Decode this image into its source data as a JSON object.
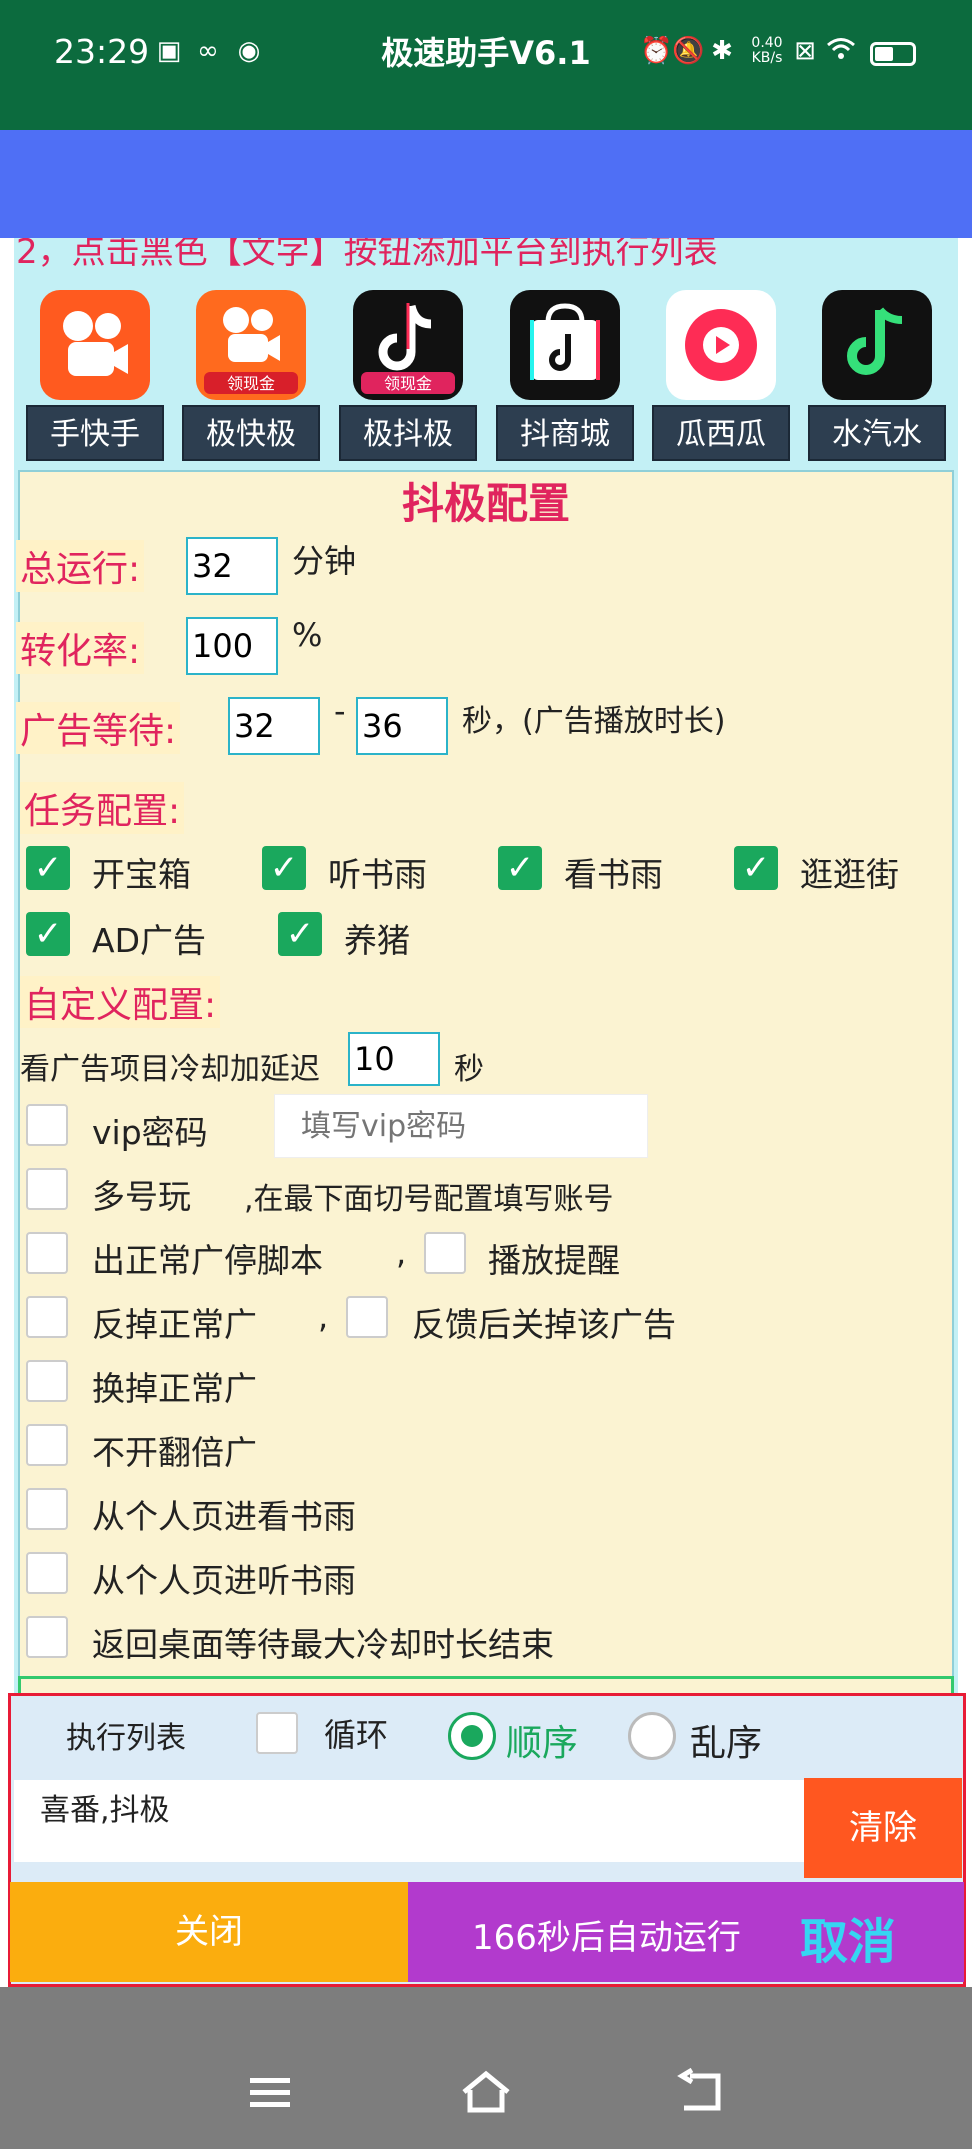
{
  "status_bar": {
    "time": "23:29",
    "net_speed_value": "0.40",
    "net_speed_unit": "KB/s",
    "icons": [
      "gallery-app-icon",
      "link-app-icon",
      "color-app-icon",
      "alarm-icon",
      "mute-icon",
      "bluetooth-icon",
      "close-box-icon",
      "wifi-icon",
      "battery-icon"
    ]
  },
  "title_bar": {
    "title": "极速助手V6.1"
  },
  "instruction": "2，点击黑色【文字】按钮添加平台到执行列表",
  "apps": [
    {
      "label": "手快手",
      "color": "#ff5a1f",
      "icon": "kuaishou-icon"
    },
    {
      "label": "极快极",
      "color": "#ff6a1e",
      "icon": "kuaishou-lite-icon",
      "badge": "领现金"
    },
    {
      "label": "极抖极",
      "color": "#111111",
      "icon": "douyin-lite-icon",
      "badge": "领现金"
    },
    {
      "label": "抖商城",
      "color": "#111111",
      "icon": "douyin-mall-icon"
    },
    {
      "label": "瓜西瓜",
      "color": "#ffffff",
      "icon": "xigua-icon"
    },
    {
      "label": "水汽水",
      "color": "#111111",
      "icon": "qishui-music-icon"
    }
  ],
  "config": {
    "title": "抖极配置",
    "total_run_label": "总运行:",
    "total_run_value": "32",
    "total_run_unit": "分钟",
    "conversion_label": "转化率:",
    "conversion_value": "100",
    "conversion_unit": "%",
    "ad_wait_label": "广告等待:",
    "ad_wait_min": "32",
    "ad_wait_sep": "-",
    "ad_wait_max": "36",
    "ad_wait_unit": "秒，(广告播放时长)",
    "task_config_label": "任务配置:",
    "tasks": [
      {
        "label": "开宝箱",
        "checked": true
      },
      {
        "label": "听书雨",
        "checked": true
      },
      {
        "label": "看书雨",
        "checked": true
      },
      {
        "label": "逛逛街",
        "checked": true
      },
      {
        "label": "AD广告",
        "checked": true
      },
      {
        "label": "养猪",
        "checked": true
      }
    ],
    "custom_config_label": "自定义配置:",
    "cooldown_label": "看广告项目冷却加延迟",
    "cooldown_value": "10",
    "cooldown_unit": "秒",
    "vip_label": "vip密码",
    "vip_placeholder": "填写vip密码",
    "multi_label": "多号玩",
    "multi_note": ",在最下面切号配置填写账号",
    "stop_label": "出正常广停脚本",
    "comma1": ",",
    "remind_label": "播放提醒",
    "feedback_label": "反掉正常广",
    "comma2": ",",
    "feedback_close_label": "反馈后关掉该广告",
    "swap_label": "换掉正常广",
    "no_double_label": "不开翻倍广",
    "from_personal_read_label": "从个人页进看书雨",
    "from_personal_listen_label": "从个人页进听书雨",
    "back_desktop_label": "返回桌面等待最大冷却时长结束"
  },
  "panel": {
    "list_label": "执行列表",
    "loop_label": "循环",
    "order_label": "顺序",
    "random_label": "乱序",
    "selected_mode": "顺序",
    "list_text": "喜番,抖极",
    "clear_label": "清除",
    "close_label": "关闭",
    "auto_run_label": "166秒后自动运行",
    "cancel_label": "取消"
  },
  "nav_bar": {
    "icons": [
      "menu-icon",
      "home-icon",
      "back-icon"
    ]
  }
}
